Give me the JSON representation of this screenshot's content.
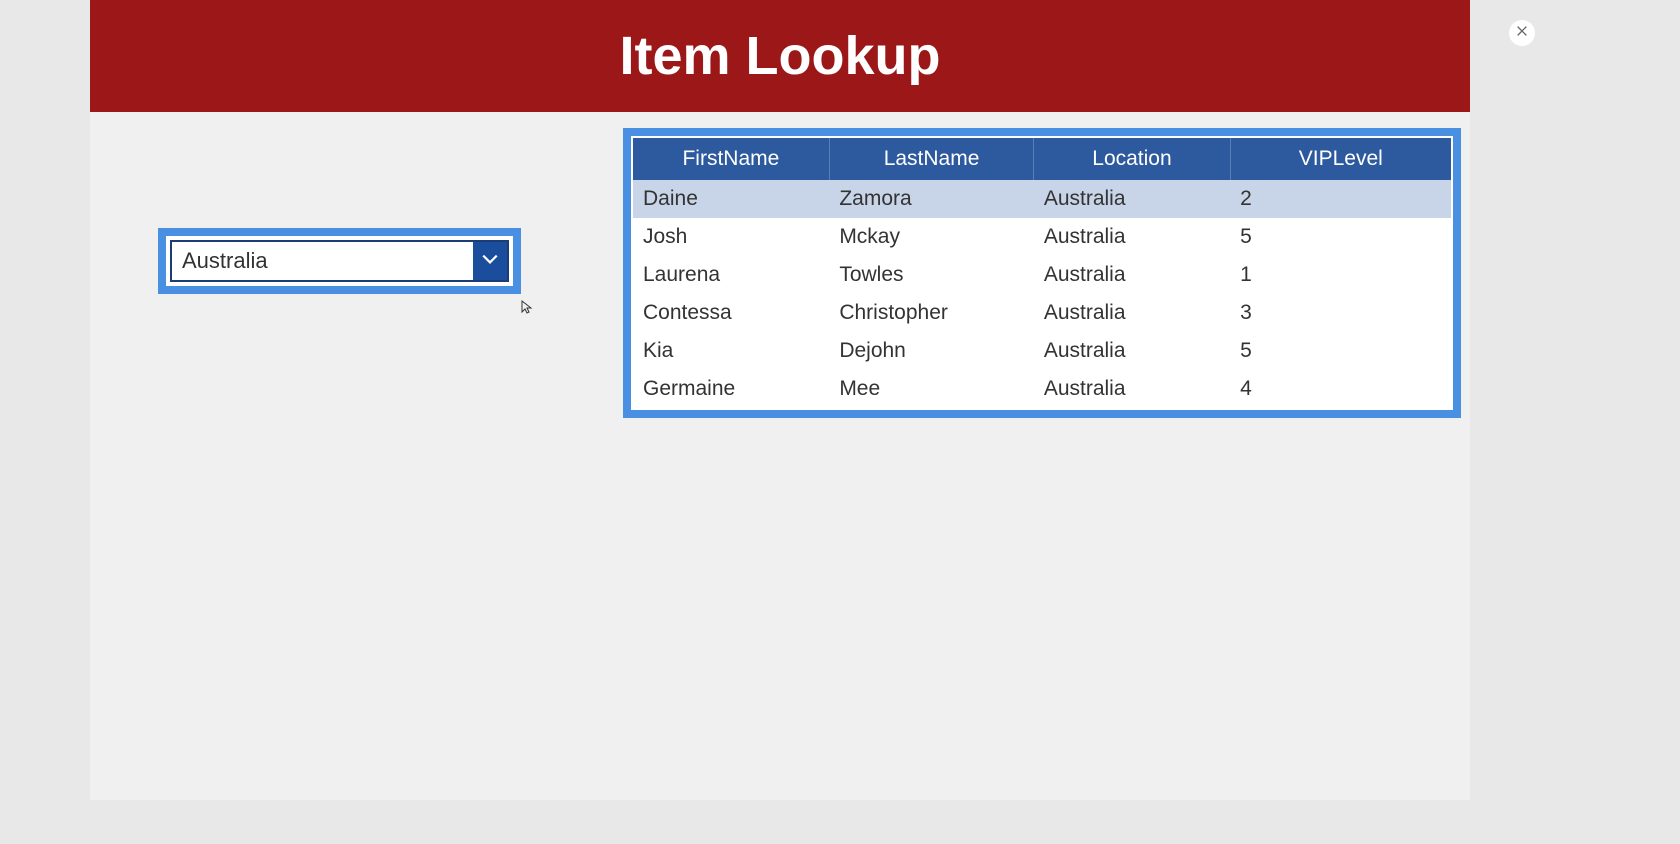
{
  "header": {
    "title": "Item Lookup"
  },
  "dropdown": {
    "selected_value": "Australia"
  },
  "table": {
    "headers": [
      "FirstName",
      "LastName",
      "Location",
      "VIPLevel"
    ],
    "rows": [
      {
        "firstName": "Daine",
        "lastName": "Zamora",
        "location": "Australia",
        "vipLevel": "2",
        "selected": true
      },
      {
        "firstName": "Josh",
        "lastName": "Mckay",
        "location": "Australia",
        "vipLevel": "5",
        "selected": false
      },
      {
        "firstName": "Laurena",
        "lastName": "Towles",
        "location": "Australia",
        "vipLevel": "1",
        "selected": false
      },
      {
        "firstName": "Contessa",
        "lastName": "Christopher",
        "location": "Australia",
        "vipLevel": "3",
        "selected": false
      },
      {
        "firstName": "Kia",
        "lastName": "Dejohn",
        "location": "Australia",
        "vipLevel": "5",
        "selected": false
      },
      {
        "firstName": "Germaine",
        "lastName": "Mee",
        "location": "Australia",
        "vipLevel": "4",
        "selected": false
      }
    ]
  }
}
